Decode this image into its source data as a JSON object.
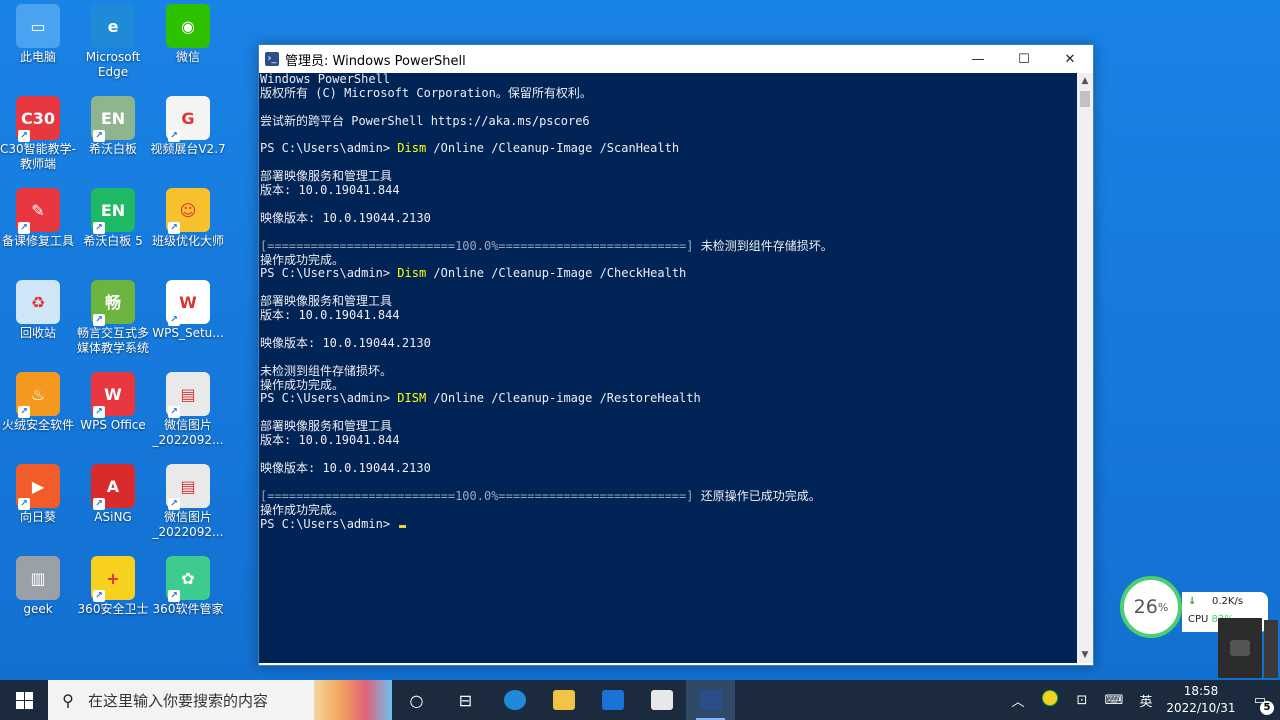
{
  "desktop": {
    "icons": [
      {
        "label": "此电脑",
        "icon": "computer-icon",
        "color": "#4aa3f0"
      },
      {
        "label": "Microsoft Edge",
        "icon": "edge-icon",
        "color": "#1f8ad8"
      },
      {
        "label": "微信",
        "icon": "wechat-icon",
        "color": "#2dc100"
      },
      {
        "label": "C30智能教学-教师端",
        "icon": "c30-icon",
        "color": "#e8373e"
      },
      {
        "label": "希沃白板",
        "icon": "seewo-whiteboard-icon",
        "color": "#8fb58f"
      },
      {
        "label": "视频展台V2.7",
        "icon": "video-booth-icon",
        "color": "#f4f4f4"
      },
      {
        "label": "备课修复工具",
        "icon": "repair-tool-icon",
        "color": "#e8373e"
      },
      {
        "label": "希沃白板 5",
        "icon": "seewo-5-icon",
        "color": "#1fb864"
      },
      {
        "label": "班级优化大师",
        "icon": "class-master-icon",
        "color": "#f6c12d"
      },
      {
        "label": "回收站",
        "icon": "recycle-bin-icon",
        "color": "#cfe6f8"
      },
      {
        "label": "畅言交互式多媒体教学系统",
        "icon": "changyan-icon",
        "color": "#6db33f"
      },
      {
        "label": "WPS_Setu...",
        "icon": "wps-setup-icon",
        "color": "#ffffff"
      },
      {
        "label": "火绒安全软件",
        "icon": "huorong-icon",
        "color": "#f39a1e"
      },
      {
        "label": "WPS Office",
        "icon": "wps-office-icon",
        "color": "#e8373e"
      },
      {
        "label": "微信图片_2022092...",
        "icon": "image-file-icon",
        "color": "#e9e9e9"
      },
      {
        "label": "向日葵",
        "icon": "sunflower-icon",
        "color": "#f25b2a"
      },
      {
        "label": "ASiNG",
        "icon": "asing-icon",
        "color": "#d92b2b"
      },
      {
        "label": "微信图片_2022092...",
        "icon": "image-file-icon",
        "color": "#e9e9e9"
      },
      {
        "label": "geek",
        "icon": "trash-can-icon",
        "color": "#9aa0a8"
      },
      {
        "label": "360安全卫士",
        "icon": "360-safe-icon",
        "color": "#f6d21e"
      },
      {
        "label": "360软件管家",
        "icon": "360-software-icon",
        "color": "#3ecb8e"
      }
    ]
  },
  "window": {
    "title": "管理员: Windows PowerShell",
    "minimize": "—",
    "maximize": "☐",
    "close": "✕",
    "lines": [
      {
        "text": "Windows PowerShell"
      },
      {
        "text": "版权所有 (C) Microsoft Corporation。保留所有权利。"
      },
      {
        "text": ""
      },
      {
        "text": "尝试新的跨平台 PowerShell https://aka.ms/pscore6"
      },
      {
        "text": ""
      },
      {
        "prompt": "PS C:\\Users\\admin> ",
        "cmd": "Dism",
        "args": " /Online /Cleanup-Image /ScanHealth"
      },
      {
        "text": ""
      },
      {
        "text": "部署映像服务和管理工具"
      },
      {
        "text": "版本: 10.0.19041.844"
      },
      {
        "text": ""
      },
      {
        "text": "映像版本: 10.0.19044.2130"
      },
      {
        "text": ""
      },
      {
        "progress": "[==========================100.0%==========================]",
        "text": " 未检测到组件存储损坏。"
      },
      {
        "text": "操作成功完成。"
      },
      {
        "prompt": "PS C:\\Users\\admin> ",
        "cmd": "Dism",
        "args": " /Online /Cleanup-Image /CheckHealth"
      },
      {
        "text": ""
      },
      {
        "text": "部署映像服务和管理工具"
      },
      {
        "text": "版本: 10.0.19041.844"
      },
      {
        "text": ""
      },
      {
        "text": "映像版本: 10.0.19044.2130"
      },
      {
        "text": ""
      },
      {
        "text": "未检测到组件存储损坏。"
      },
      {
        "text": "操作成功完成。"
      },
      {
        "prompt": "PS C:\\Users\\admin> ",
        "cmd": "DISM",
        "args": " /Online /Cleanup-image /RestoreHealth"
      },
      {
        "text": ""
      },
      {
        "text": "部署映像服务和管理工具"
      },
      {
        "text": "版本: 10.0.19041.844"
      },
      {
        "text": ""
      },
      {
        "text": "映像版本: 10.0.19044.2130"
      },
      {
        "text": ""
      },
      {
        "progress": "[==========================100.0%==========================]",
        "text": " 还原操作已成功完成。"
      },
      {
        "text": "操作成功完成。"
      },
      {
        "prompt": "PS C:\\Users\\admin> ",
        "cursor": true
      }
    ]
  },
  "monitor": {
    "percent": "26",
    "unit": "%",
    "net_speed": "0.2K/s",
    "cpu_label": "CPU",
    "cpu_value": "83%"
  },
  "taskbar": {
    "search_placeholder": "在这里输入你要搜索的内容",
    "apps": [
      {
        "name": "task-view-button",
        "icon": "○"
      },
      {
        "name": "timeline-button",
        "icon": "⊟"
      },
      {
        "name": "taskbar-edge",
        "color": "#1f8ad8"
      },
      {
        "name": "taskbar-file-explorer",
        "color": "#f3c444"
      },
      {
        "name": "taskbar-mail",
        "color": "#1a73d6"
      },
      {
        "name": "taskbar-store",
        "color": "#e8e8e8"
      },
      {
        "name": "taskbar-powershell",
        "color": "#2b4d8a",
        "active": true
      }
    ],
    "ime": "英",
    "time": "18:58",
    "date": "2022/10/31",
    "notification_count": "5"
  }
}
